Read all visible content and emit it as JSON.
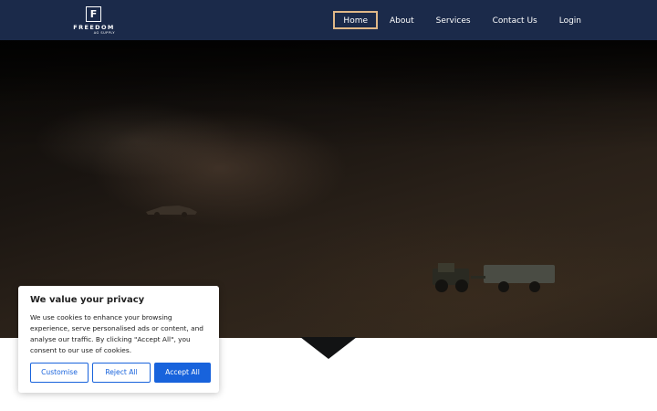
{
  "brand": {
    "logo_letter": "F",
    "name": "FREEDOM",
    "tagline": "AG SUPPLY"
  },
  "nav": {
    "items": [
      {
        "label": "Home",
        "active": true
      },
      {
        "label": "About",
        "active": false
      },
      {
        "label": "Services",
        "active": false
      },
      {
        "label": "Contact Us",
        "active": false
      },
      {
        "label": "Login",
        "active": false
      }
    ]
  },
  "cookie_banner": {
    "title": "We value your privacy",
    "text": "We use cookies to enhance your browsing experience, serve personalised ads or content, and analyse our traffic. By clicking \"Accept All\", you consent to our use of cookies.",
    "customise_label": "Customise",
    "reject_label": "Reject All",
    "accept_label": "Accept All"
  },
  "colors": {
    "header_bg": "#1b2a4a",
    "active_nav_border": "#e0b888",
    "button_blue": "#1863dc"
  }
}
